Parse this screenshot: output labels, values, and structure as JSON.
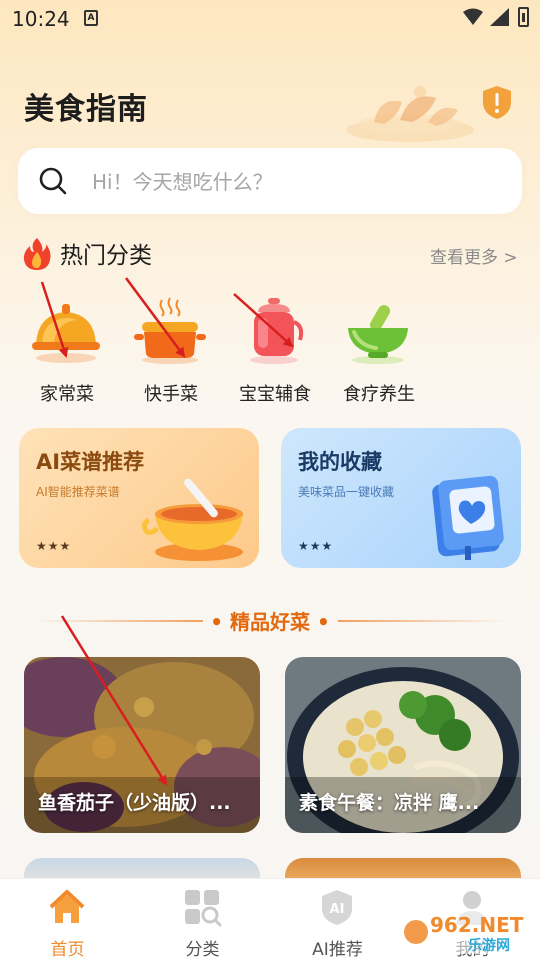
{
  "status_bar": {
    "time": "10:24",
    "notification_letter": "A"
  },
  "header": {
    "title": "美食指南"
  },
  "search": {
    "placeholder": "Hi！今天想吃什么？"
  },
  "hot_categories": {
    "title": "热门分类",
    "more": "查看更多 >",
    "items": [
      {
        "label": "家常菜",
        "icon": "cloche-icon"
      },
      {
        "label": "快手菜",
        "icon": "pot-icon"
      },
      {
        "label": "宝宝辅食",
        "icon": "kettle-icon"
      },
      {
        "label": "食疗养生",
        "icon": "mortar-icon"
      }
    ]
  },
  "feature_cards": {
    "ai": {
      "title": "AI菜谱推荐",
      "subtitle": "AI智能推荐菜谱",
      "dots": "★★★"
    },
    "favorites": {
      "title": "我的收藏",
      "subtitle": "美味菜品一键收藏",
      "dots": "★★★"
    }
  },
  "premium": {
    "title": "• 精品好菜 •",
    "dishes": [
      {
        "title": "鱼香茄子（少油版）..."
      },
      {
        "title": "素食午餐：凉拌 鹰..."
      }
    ]
  },
  "tab_bar": {
    "tabs": [
      {
        "label": "首页",
        "icon": "home-icon"
      },
      {
        "label": "分类",
        "icon": "grid-search-icon"
      },
      {
        "label": "AI推荐",
        "icon": "ai-badge-icon"
      },
      {
        "label": "我的",
        "icon": "profile-icon"
      }
    ]
  },
  "watermark": {
    "brand": "962.NET",
    "sub": "乐游网"
  },
  "colors": {
    "accent": "#f08a2c",
    "premium_title": "#e2690f",
    "ai_card": "#fdc98a",
    "favorites_card": "#a8d3fb",
    "annotation_arrow": "#d81e1e"
  }
}
